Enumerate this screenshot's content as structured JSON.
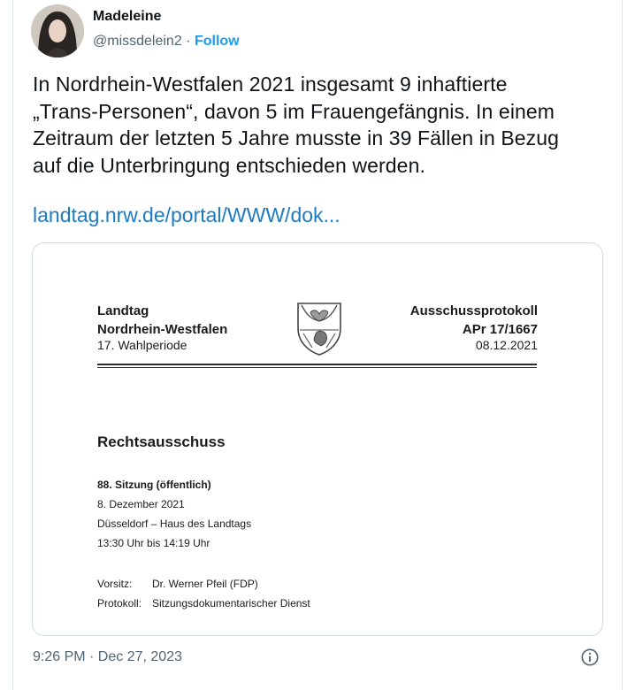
{
  "author": {
    "name": "Madeleine",
    "handle": "@missdelein2",
    "separator": "·",
    "follow_label": "Follow"
  },
  "tweet": {
    "lines": [
      "In Nordrhein-Westfalen 2021 insgesamt 9 inhaftierte",
      "„Trans-Personen“, davon 5 im Frauengefängnis. In einem",
      "Zeitraum der letzten 5 Jahre musste in 39 Fällen in Bezug",
      "auf die Unterbringung entschieden werden."
    ],
    "link_text": "landtag.nrw.de/portal/WWW/dok..."
  },
  "document": {
    "org_line1": "Landtag",
    "org_line2": "Nordrhein-Westfalen",
    "period": "17. Wahlperiode",
    "protocol_title": "Ausschussprotokoll",
    "protocol_number": "APr 17/1667",
    "protocol_date": "08.12.2021",
    "committee": "Rechtsausschuss",
    "session": "88. Sitzung (öffentlich)",
    "session_date": "8. Dezember 2021",
    "location": "Düsseldorf – Haus des Landtags",
    "time": "13:30 Uhr bis 14:19 Uhr",
    "chair_label": "Vorsitz:",
    "chair_value": "Dr. Werner Pfeil (FDP)",
    "minutes_label": "Protokoll:",
    "minutes_value": "Sitzungsdokumentarischer Dienst"
  },
  "footer": {
    "timestamp": "9:26 PM · Dec 27, 2023"
  },
  "icons": {
    "info": "info-icon",
    "crest": "crest-icon"
  },
  "colors": {
    "link": "#1d7bc4",
    "follow": "#1d9bf0",
    "muted": "#536471"
  }
}
